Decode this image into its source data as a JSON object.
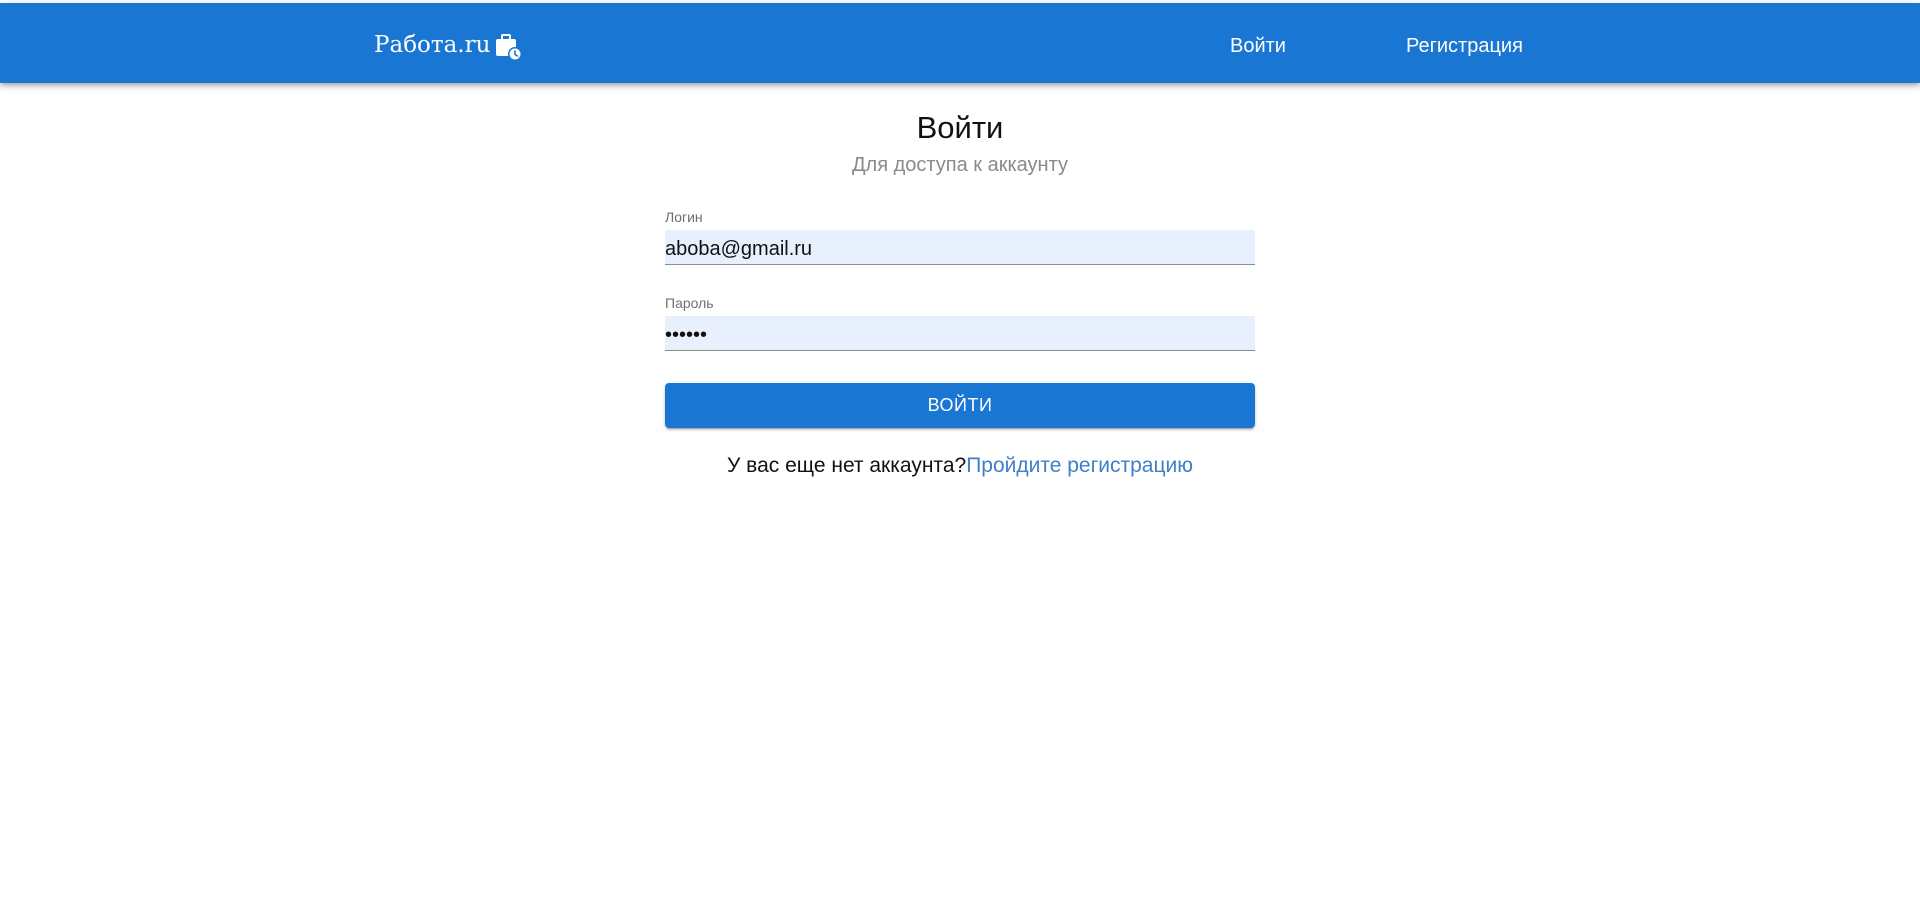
{
  "header": {
    "brand": "Работа.ru",
    "brand_icon": "briefcase-clock-icon",
    "nav": {
      "login": "Войти",
      "register": "Регистрация"
    },
    "color": "#1976d2"
  },
  "main": {
    "title": "Войти",
    "subtitle": "Для доступа к аккаунту",
    "login_field": {
      "label": "Логин",
      "value": "aboba@gmail.ru"
    },
    "password_field": {
      "label": "Пароль",
      "value": "••••••"
    },
    "submit_label": "ВОЙТИ",
    "signup": {
      "prompt": "У вас еще нет аккаунта?",
      "link": "Пройдите регистрацию"
    }
  },
  "colors": {
    "primary": "#1976d2",
    "input_bg": "#e8f0fe",
    "link": "#3f7fc9",
    "muted": "#8a8a8a"
  }
}
